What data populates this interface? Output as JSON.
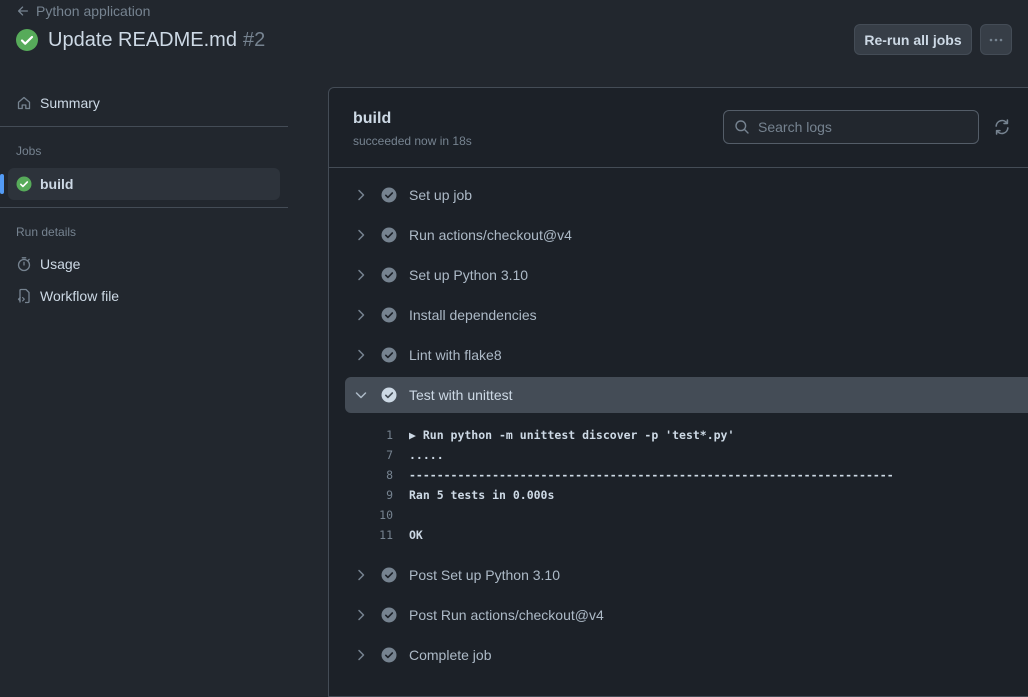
{
  "header": {
    "back_label": "Python application",
    "title": "Update README.md",
    "run_number": "#2",
    "rerun_label": "Re-run all jobs",
    "more_label": "···"
  },
  "sidebar": {
    "summary_label": "Summary",
    "jobs_heading": "Jobs",
    "job_build_label": "build",
    "run_details_heading": "Run details",
    "usage_label": "Usage",
    "workflow_file_label": "Workflow file"
  },
  "job": {
    "title": "build",
    "subtitle": "succeeded now in 18s",
    "search_placeholder": "Search logs"
  },
  "steps": [
    {
      "label": "Set up job"
    },
    {
      "label": "Run actions/checkout@v4"
    },
    {
      "label": "Set up Python 3.10"
    },
    {
      "label": "Install dependencies"
    },
    {
      "label": "Lint with flake8"
    },
    {
      "label": "Test with unittest"
    },
    {
      "label": "Post Set up Python 3.10"
    },
    {
      "label": "Post Run actions/checkout@v4"
    },
    {
      "label": "Complete job"
    }
  ],
  "log": [
    {
      "num": "1",
      "text": "▶ Run python -m unittest discover -p 'test*.py'"
    },
    {
      "num": "7",
      "text": "....."
    },
    {
      "num": "8",
      "text": "----------------------------------------------------------------------"
    },
    {
      "num": "9",
      "text": "Ran 5 tests in 0.000s"
    },
    {
      "num": "10",
      "text": ""
    },
    {
      "num": "11",
      "text": "OK"
    }
  ],
  "colors": {
    "success": "#57ab5a",
    "step_check": "#768390",
    "accent": "#539bf5"
  }
}
